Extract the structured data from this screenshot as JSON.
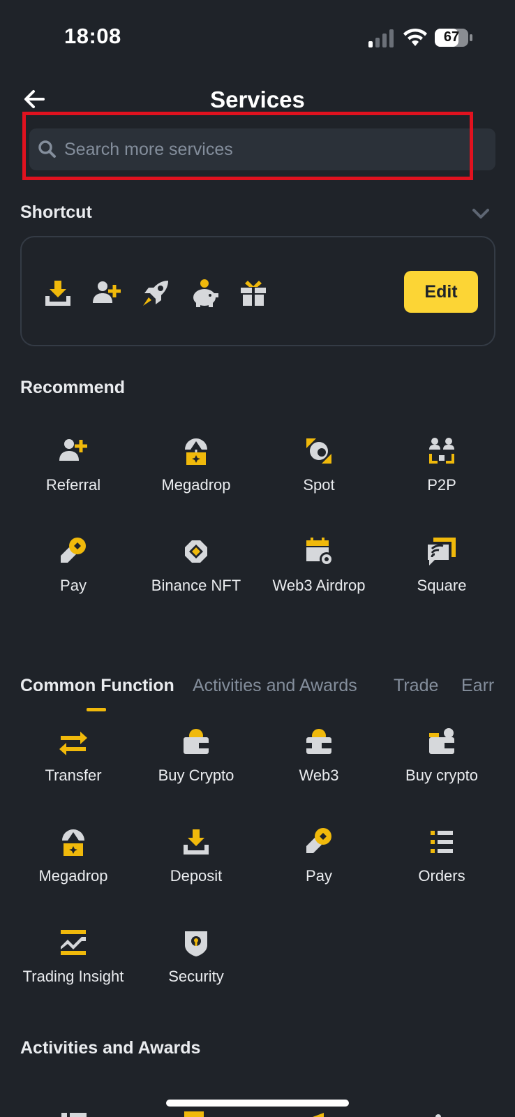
{
  "status_bar": {
    "time": "18:08",
    "battery": "67"
  },
  "header": {
    "title": "Services"
  },
  "search": {
    "placeholder": "Search more services"
  },
  "shortcut": {
    "title": "Shortcut",
    "edit_label": "Edit",
    "icons": [
      "deposit-icon",
      "referral-icon",
      "launchpad-icon",
      "savings-icon",
      "gift-icon"
    ]
  },
  "recommend": {
    "title": "Recommend",
    "items": [
      {
        "label": "Referral",
        "icon": "referral-icon"
      },
      {
        "label": "Megadrop",
        "icon": "megadrop-icon"
      },
      {
        "label": "Spot",
        "icon": "spot-icon"
      },
      {
        "label": "P2P",
        "icon": "p2p-icon"
      },
      {
        "label": "Pay",
        "icon": "pay-icon"
      },
      {
        "label": "Binance NFT",
        "icon": "nft-icon"
      },
      {
        "label": "Web3 Airdrop",
        "icon": "web3-airdrop-icon"
      },
      {
        "label": "Square",
        "icon": "square-icon"
      }
    ]
  },
  "tabs": [
    {
      "label": "Common Function",
      "active": true
    },
    {
      "label": "Activities and Awards",
      "active": false
    },
    {
      "label": "Trade",
      "active": false
    },
    {
      "label": "Earr",
      "active": false
    }
  ],
  "common_function": {
    "items": [
      {
        "label": "Transfer",
        "icon": "transfer-icon"
      },
      {
        "label": "Buy Crypto",
        "icon": "buy-crypto-icon"
      },
      {
        "label": "Web3",
        "icon": "web3-wallet-icon"
      },
      {
        "label": "Buy crypto",
        "icon": "buy-crypto-p2p-icon"
      },
      {
        "label": "Megadrop",
        "icon": "megadrop-icon"
      },
      {
        "label": "Deposit",
        "icon": "deposit-icon"
      },
      {
        "label": "Pay",
        "icon": "pay-icon"
      },
      {
        "label": "Orders",
        "icon": "orders-icon"
      },
      {
        "label": "Trading Insight",
        "icon": "trading-insight-icon"
      },
      {
        "label": "Security",
        "icon": "security-icon"
      }
    ]
  },
  "activities": {
    "title": "Activities and Awards"
  },
  "colors": {
    "background": "#1f2329",
    "accent": "#f0b90b",
    "edit_button": "#fcd535",
    "icon_grey": "#d6d8db",
    "highlight_box": "#e0121f"
  }
}
